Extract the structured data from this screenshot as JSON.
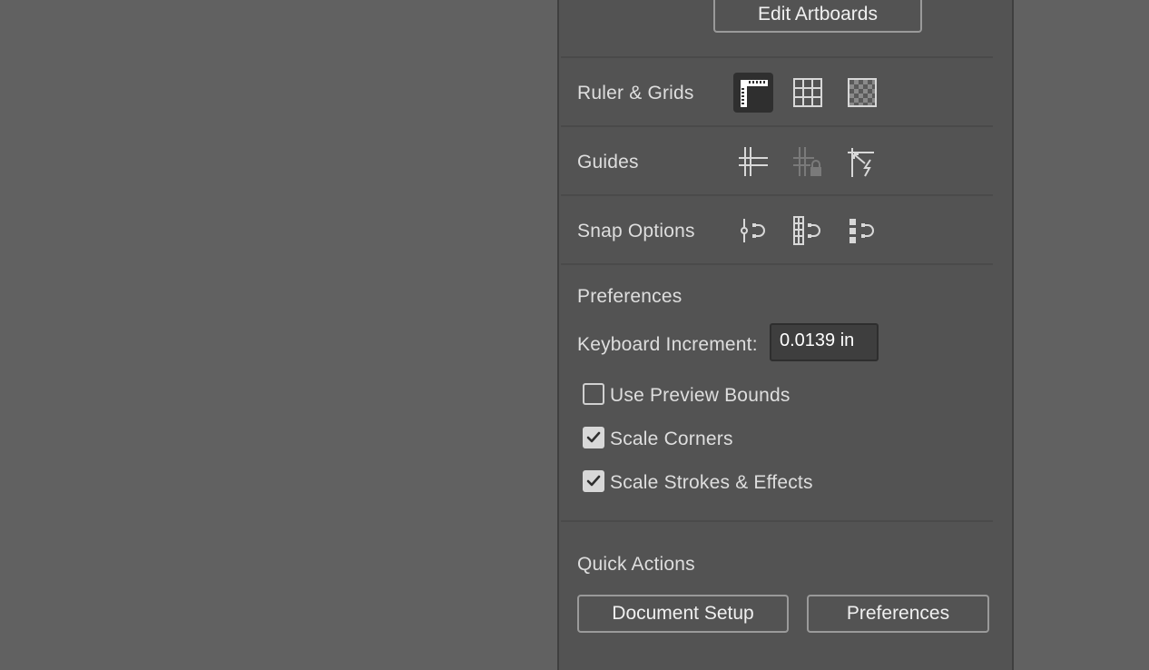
{
  "edit_artboards_label": "Edit Artboards",
  "sections": {
    "ruler_grids": {
      "label": "Ruler & Grids",
      "icons": [
        "rulers-icon",
        "grid-icon",
        "transparency-grid-icon"
      ]
    },
    "guides": {
      "label": "Guides",
      "icons": [
        "guides-icon",
        "lock-guides-icon",
        "smart-guides-icon"
      ]
    },
    "snap": {
      "label": "Snap Options",
      "icons": [
        "snap-to-point-icon",
        "snap-to-grid-icon",
        "snap-to-pixel-icon"
      ]
    }
  },
  "preferences": {
    "heading": "Preferences",
    "keyboard_increment_label": "Keyboard Increment:",
    "keyboard_increment_value": "0.0139 in",
    "checkboxes": [
      {
        "label": "Use Preview Bounds",
        "checked": false
      },
      {
        "label": "Scale Corners",
        "checked": true
      },
      {
        "label": "Scale Strokes & Effects",
        "checked": true
      }
    ]
  },
  "quick_actions": {
    "heading": "Quick Actions",
    "document_setup_label": "Document Setup",
    "preferences_label": "Preferences"
  },
  "colors": {
    "panel_bg": "#535353",
    "canvas_bg": "#616161",
    "active_icon_bg": "#2f2f2f"
  }
}
